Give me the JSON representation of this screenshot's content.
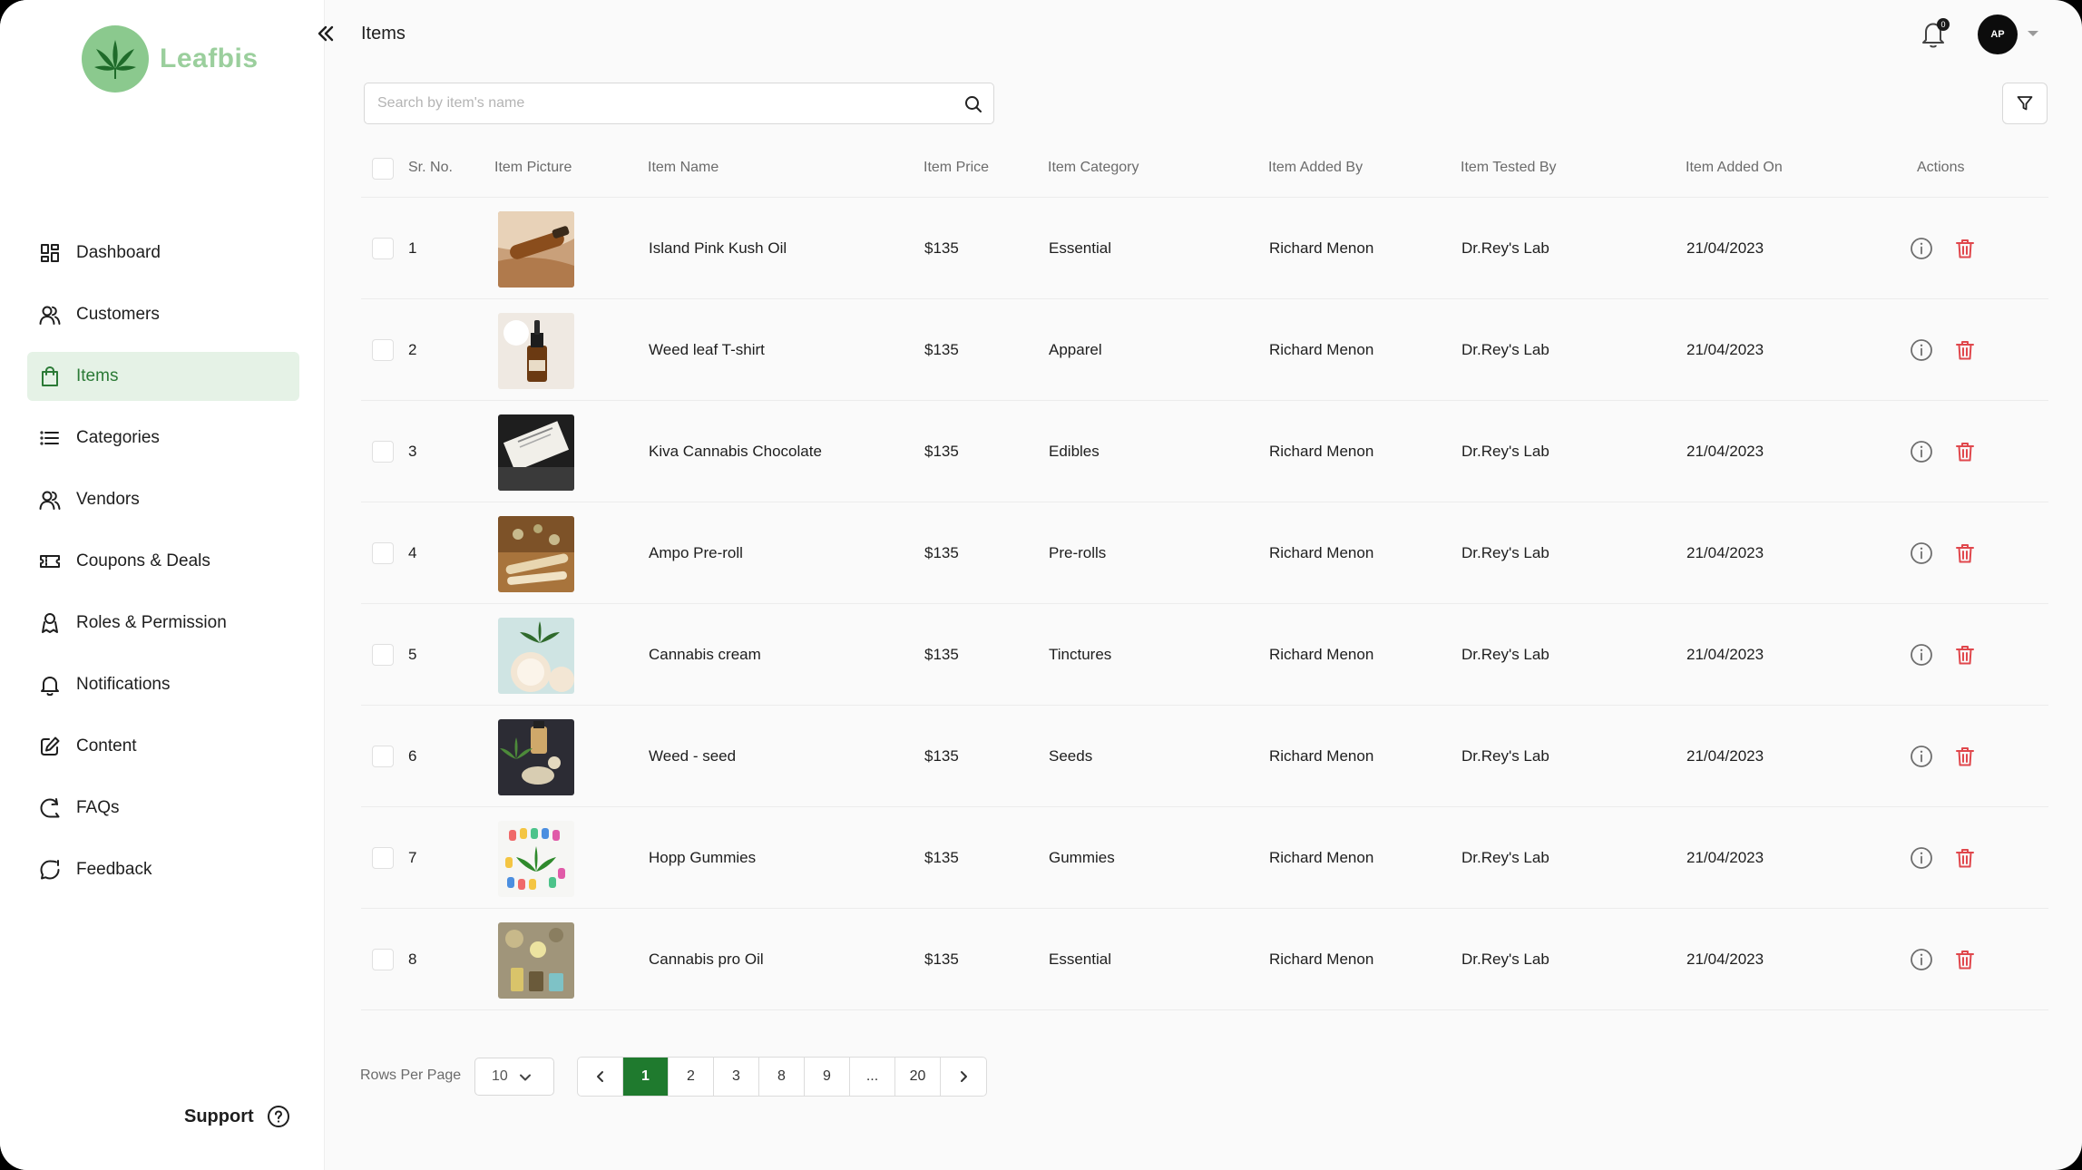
{
  "brand": {
    "name": "Leafbis"
  },
  "header": {
    "title": "Items",
    "notification_count": "0",
    "avatar_initials": "AP"
  },
  "sidebar": {
    "items": [
      {
        "label": "Dashboard",
        "icon": "dashboard-icon",
        "active": false
      },
      {
        "label": "Customers",
        "icon": "users-icon",
        "active": false
      },
      {
        "label": "Items",
        "icon": "shopping-bag-icon",
        "active": true
      },
      {
        "label": "Categories",
        "icon": "list-icon",
        "active": false
      },
      {
        "label": "Vendors",
        "icon": "users-icon",
        "active": false
      },
      {
        "label": "Coupons & Deals",
        "icon": "ticket-icon",
        "active": false
      },
      {
        "label": "Roles & Permission",
        "icon": "user-badge-icon",
        "active": false
      },
      {
        "label": "Notifications",
        "icon": "bell-icon",
        "active": false
      },
      {
        "label": "Content",
        "icon": "edit-icon",
        "active": false
      },
      {
        "label": "FAQs",
        "icon": "faq-icon",
        "active": false
      },
      {
        "label": "Feedback",
        "icon": "feedback-icon",
        "active": false
      }
    ],
    "support_label": "Support"
  },
  "search": {
    "placeholder": "Search by item's name",
    "value": ""
  },
  "table": {
    "columns": [
      "Sr. No.",
      "Item Picture",
      "Item Name",
      "Item Price",
      "Item Category",
      "Item Added By",
      "Item Tested By",
      "Item Added On",
      "Actions"
    ],
    "rows": [
      {
        "sr": "1",
        "name": "Island Pink Kush Oil",
        "price": "$135",
        "category": "Essential",
        "added_by": "Richard Menon",
        "tested_by": "Dr.Rey's Lab",
        "added_on": "21/04/2023",
        "thumb": "oil-dropper"
      },
      {
        "sr": "2",
        "name": "Weed leaf T-shirt",
        "price": "$135",
        "category": "Apparel",
        "added_by": "Richard Menon",
        "tested_by": "Dr.Rey's Lab",
        "added_on": "21/04/2023",
        "thumb": "amber-bottle"
      },
      {
        "sr": "3",
        "name": "Kiva Cannabis Chocolate",
        "price": "$135",
        "category": "Edibles",
        "added_by": "Richard Menon",
        "tested_by": "Dr.Rey's Lab",
        "added_on": "21/04/2023",
        "thumb": "chocolate-box"
      },
      {
        "sr": "4",
        "name": "Ampo Pre-roll",
        "price": "$135",
        "category": "Pre-rolls",
        "added_by": "Richard Menon",
        "tested_by": "Dr.Rey's Lab",
        "added_on": "21/04/2023",
        "thumb": "pre-roll"
      },
      {
        "sr": "5",
        "name": "Cannabis cream",
        "price": "$135",
        "category": "Tinctures",
        "added_by": "Richard Menon",
        "tested_by": "Dr.Rey's Lab",
        "added_on": "21/04/2023",
        "thumb": "cream-leaf"
      },
      {
        "sr": "6",
        "name": "Weed - seed",
        "price": "$135",
        "category": "Seeds",
        "added_by": "Richard Menon",
        "tested_by": "Dr.Rey's Lab",
        "added_on": "21/04/2023",
        "thumb": "seeds"
      },
      {
        "sr": "7",
        "name": "Hopp Gummies",
        "price": "$135",
        "category": "Gummies",
        "added_by": "Richard Menon",
        "tested_by": "Dr.Rey's Lab",
        "added_on": "21/04/2023",
        "thumb": "gummies"
      },
      {
        "sr": "8",
        "name": "Cannabis pro Oil",
        "price": "$135",
        "category": "Essential",
        "added_by": "Richard Menon",
        "tested_by": "Dr.Rey's Lab",
        "added_on": "21/04/2023",
        "thumb": "pro-oil"
      }
    ]
  },
  "pagination": {
    "rows_per_page_label": "Rows Per Page",
    "rows_per_page_value": "10",
    "pages": [
      "1",
      "2",
      "3",
      "8",
      "9",
      "...",
      "20"
    ],
    "current": "1"
  },
  "colors": {
    "accent": "#1f7a2e",
    "active_bg": "#e5f2e6",
    "delete": "#e0474c",
    "brand_light": "#8bc98e"
  }
}
